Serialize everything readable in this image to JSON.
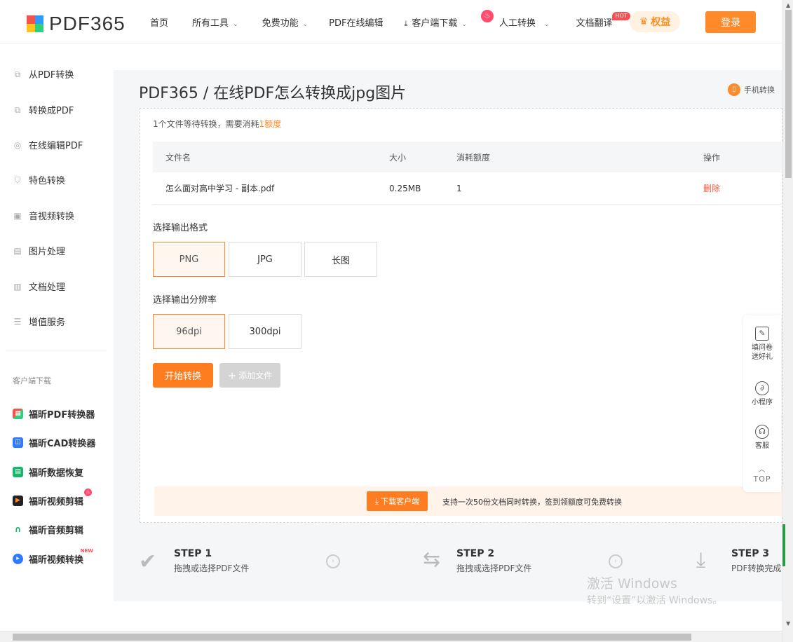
{
  "header": {
    "logo_text": "PDF365",
    "nav": [
      {
        "label": "首页",
        "caret": false
      },
      {
        "label": "所有工具",
        "caret": true
      },
      {
        "label": "免费功能",
        "caret": true
      },
      {
        "label": "PDF在线编辑",
        "caret": false
      },
      {
        "label": "客户端下载",
        "caret": true
      },
      {
        "label": "人工转换",
        "caret": true
      },
      {
        "label": "文档翻译",
        "caret": false
      }
    ],
    "hot_badge": "HOT",
    "rights_label": "权益",
    "login_label": "登录"
  },
  "sidebar": {
    "items": [
      {
        "label": "从PDF转换",
        "icon": "convert-from-pdf-icon"
      },
      {
        "label": "转换成PDF",
        "icon": "convert-to-pdf-icon"
      },
      {
        "label": "在线编辑PDF",
        "icon": "edit-pdf-icon"
      },
      {
        "label": "特色转换",
        "icon": "shield-icon"
      },
      {
        "label": "音视频转换",
        "icon": "media-icon"
      },
      {
        "label": "图片处理",
        "icon": "image-icon"
      },
      {
        "label": "文档处理",
        "icon": "document-icon"
      },
      {
        "label": "增值服务",
        "icon": "list-icon"
      }
    ],
    "download_heading": "客户端下载",
    "apps": [
      {
        "label": "福昕PDF转换器",
        "color": "#ffb11f",
        "badge": ""
      },
      {
        "label": "福昕CAD转换器",
        "color": "#2f7bff",
        "badge": ""
      },
      {
        "label": "福昕数据恢复",
        "color": "#18b56a",
        "badge": ""
      },
      {
        "label": "福昕视频剪辑",
        "color": "#222222",
        "badge": "fire"
      },
      {
        "label": "福昕音频剪辑",
        "color": "#19b96a",
        "badge": ""
      },
      {
        "label": "福昕视频转换",
        "color": "#2f7bff",
        "badge": "NEW"
      }
    ]
  },
  "main": {
    "title": "PDF365 / 在线PDF怎么转换成jpg图片",
    "mobile_convert": "手机转换",
    "note_prefix": "1个文件等待转换，需要消耗",
    "note_highlight": "1额度",
    "table": {
      "headers": [
        "文件名",
        "大小",
        "消耗额度",
        "操作"
      ],
      "rows": [
        {
          "filename": "怎么面对高中学习 - 副本.pdf",
          "size": "0.25MB",
          "quota": "1",
          "action": "删除"
        }
      ]
    },
    "format_label": "选择输出格式",
    "formats": [
      "PNG",
      "JPG",
      "长图"
    ],
    "format_selected": "PNG",
    "resolution_label": "选择输出分辨率",
    "resolutions": [
      "96dpi",
      "300dpi"
    ],
    "resolution_selected": "96dpi",
    "start_button": "开始转换",
    "add_button": "添加文件",
    "download_client_button": "下载客户端",
    "promo_text": "支持一次50份文档同时转换，签到领额度可免费转换"
  },
  "float_panel": {
    "survey": "填问卷送好礼",
    "miniprogram": "小程序",
    "service": "客服",
    "top": "TOP"
  },
  "steps": [
    {
      "title": "STEP 1",
      "desc": "拖拽或选择PDF文件"
    },
    {
      "title": "STEP 2",
      "desc": "拖拽或选择PDF文件"
    },
    {
      "title": "STEP 3",
      "desc": "PDF转换完成"
    }
  ],
  "watermark": {
    "line1": "激活 Windows",
    "line2": "转到“设置”以激活 Windows。"
  }
}
